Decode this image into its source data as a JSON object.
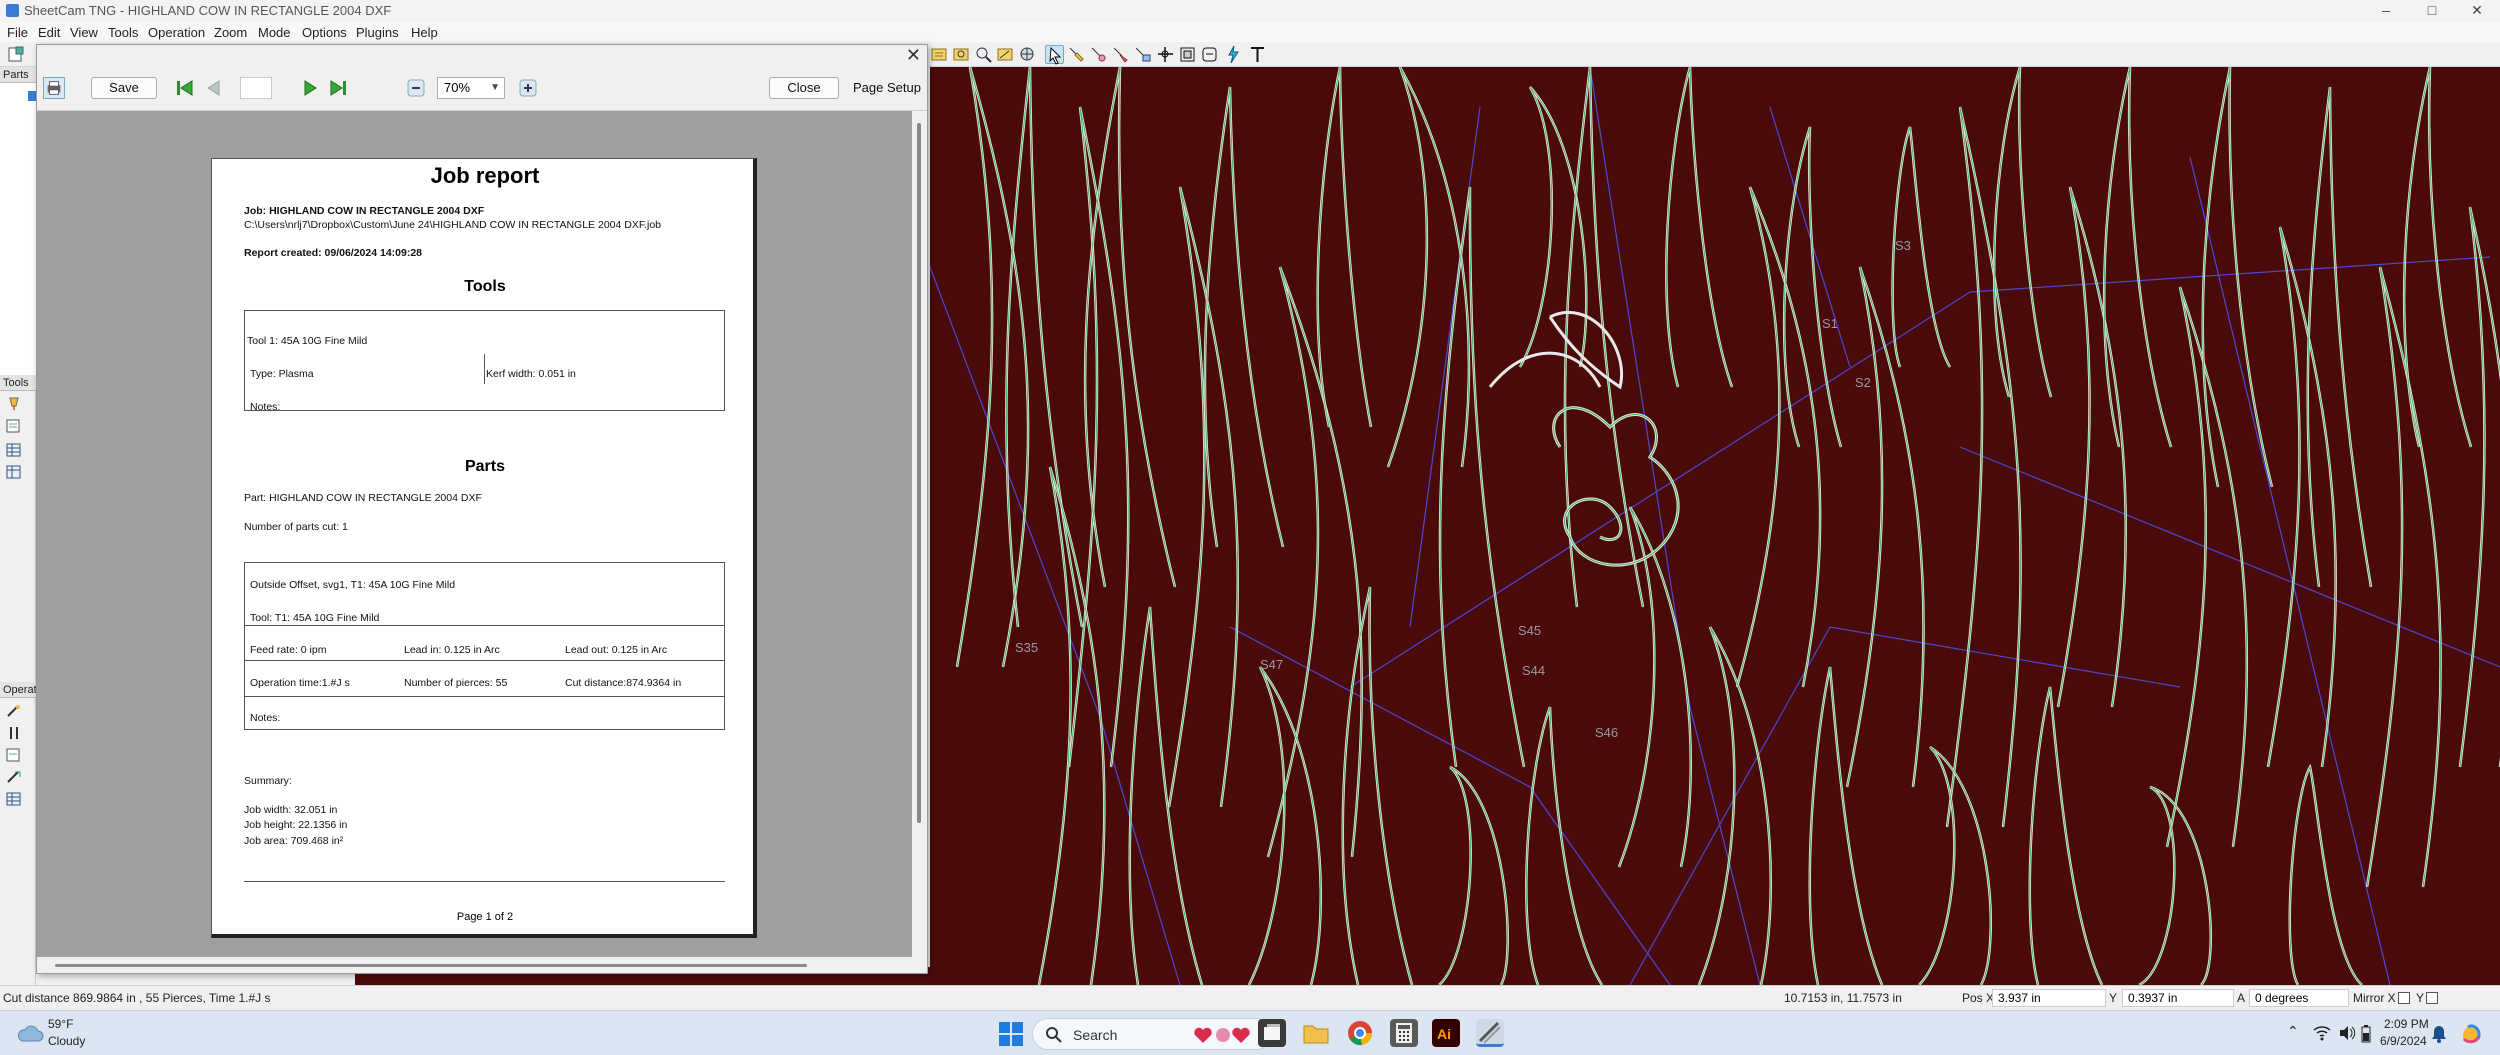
{
  "window": {
    "title": "SheetCam TNG - HIGHLAND COW IN RECTANGLE 2004 DXF",
    "controls": [
      "–",
      "□",
      "✕"
    ]
  },
  "menu": [
    "File",
    "Edit",
    "View",
    "Tools",
    "Operation",
    "Zoom",
    "Mode",
    "Options",
    "Plugins",
    "Help"
  ],
  "left_panel": {
    "parts_label": "Parts",
    "tools_label": "Tools",
    "operations_label": "Operat"
  },
  "dialog": {
    "close_x": "✕",
    "save_label": "Save",
    "zoom_value": "70%",
    "close_label": "Close",
    "page_setup_label": "Page Setup",
    "page_value": ""
  },
  "report": {
    "title": "Job report",
    "job_line": "Job: HIGHLAND COW IN RECTANGLE 2004 DXF",
    "path_line": "C:\\Users\\nrlj7\\Dropbox\\Custom\\June 24\\HIGHLAND COW IN RECTANGLE 2004 DXF.job",
    "created_line": "Report created: 09/06/2024 14:09:28",
    "tools_heading": "Tools",
    "tool_name": "Tool 1: 45A 10G Fine Mild",
    "tool_type": "Type: Plasma",
    "kerf": "Kerf width: 0.051 in",
    "tool_notes": "Notes:",
    "parts_heading": "Parts",
    "part_line": "Part: HIGHLAND COW IN RECTANGLE 2004 DXF",
    "parts_cut": "Number of parts cut: 1",
    "op_name": "Outside Offset, svg1, T1: 45A 10G Fine Mild",
    "op_tool": "Tool: T1: 45A 10G Fine Mild",
    "feed_rate": "Feed rate: 0 ipm",
    "lead_in": "Lead in: 0.125 in Arc",
    "lead_out": "Lead out: 0.125 in Arc",
    "op_time": "Operation time:1.#J s",
    "pierces": "Number of pierces: 55",
    "cut_distance": "Cut distance:874.9364 in",
    "op_notes": "Notes:",
    "summary_label": "Summary:",
    "job_width": "Job width: 32.051 in",
    "job_height": "Job height: 22.1356 in",
    "job_area": "Job area: 709.468 in²",
    "page_footer": "Page 1 of 2"
  },
  "canvas_labels": {
    "s1": "S1",
    "s2": "S2",
    "s3": "S3",
    "s35": "S35",
    "s44": "S44",
    "s45": "S45",
    "s46": "S46",
    "s47": "S47"
  },
  "status": {
    "cut_info": "Cut distance 869.9864 in , 55 Pierces, Time 1.#J s",
    "coords": "10.7153 in, 11.7573 in",
    "pos_x_label": "Pos X",
    "pos_x_value": "3.937 in",
    "y_label": "Y",
    "y_value": "0.3937 in",
    "a_label": "A",
    "a_value": "0 degrees",
    "mirror_x_label": "Mirror X",
    "mirror_y_label": "Y"
  },
  "taskbar": {
    "temperature": "59°F",
    "weather": "Cloudy",
    "search_label": "Search",
    "time": "2:09 PM",
    "date": "6/9/2024"
  },
  "colors": {
    "canvas_bg": "#4a0a0a",
    "contour_outer": "#e8e8e8",
    "contour_inner": "#3fae5a",
    "path_lines": "#4a4ad0"
  }
}
